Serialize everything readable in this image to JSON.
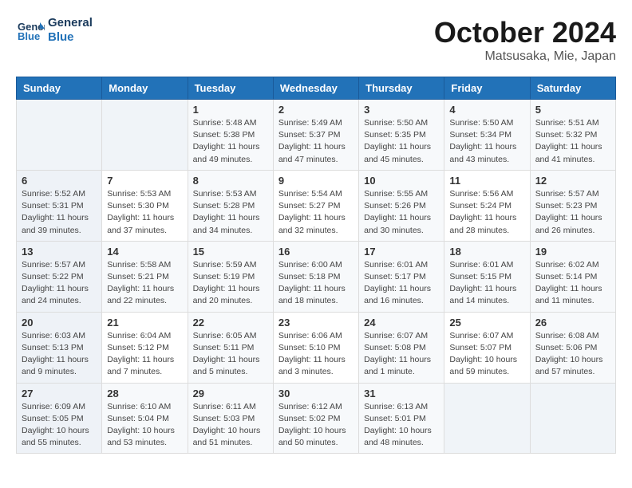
{
  "header": {
    "logo_line1": "General",
    "logo_line2": "Blue",
    "month_title": "October 2024",
    "location": "Matsusaka, Mie, Japan"
  },
  "weekdays": [
    "Sunday",
    "Monday",
    "Tuesday",
    "Wednesday",
    "Thursday",
    "Friday",
    "Saturday"
  ],
  "weeks": [
    [
      {
        "day": "",
        "info": ""
      },
      {
        "day": "",
        "info": ""
      },
      {
        "day": "1",
        "info": "Sunrise: 5:48 AM\nSunset: 5:38 PM\nDaylight: 11 hours and 49 minutes."
      },
      {
        "day": "2",
        "info": "Sunrise: 5:49 AM\nSunset: 5:37 PM\nDaylight: 11 hours and 47 minutes."
      },
      {
        "day": "3",
        "info": "Sunrise: 5:50 AM\nSunset: 5:35 PM\nDaylight: 11 hours and 45 minutes."
      },
      {
        "day": "4",
        "info": "Sunrise: 5:50 AM\nSunset: 5:34 PM\nDaylight: 11 hours and 43 minutes."
      },
      {
        "day": "5",
        "info": "Sunrise: 5:51 AM\nSunset: 5:32 PM\nDaylight: 11 hours and 41 minutes."
      }
    ],
    [
      {
        "day": "6",
        "info": "Sunrise: 5:52 AM\nSunset: 5:31 PM\nDaylight: 11 hours and 39 minutes."
      },
      {
        "day": "7",
        "info": "Sunrise: 5:53 AM\nSunset: 5:30 PM\nDaylight: 11 hours and 37 minutes."
      },
      {
        "day": "8",
        "info": "Sunrise: 5:53 AM\nSunset: 5:28 PM\nDaylight: 11 hours and 34 minutes."
      },
      {
        "day": "9",
        "info": "Sunrise: 5:54 AM\nSunset: 5:27 PM\nDaylight: 11 hours and 32 minutes."
      },
      {
        "day": "10",
        "info": "Sunrise: 5:55 AM\nSunset: 5:26 PM\nDaylight: 11 hours and 30 minutes."
      },
      {
        "day": "11",
        "info": "Sunrise: 5:56 AM\nSunset: 5:24 PM\nDaylight: 11 hours and 28 minutes."
      },
      {
        "day": "12",
        "info": "Sunrise: 5:57 AM\nSunset: 5:23 PM\nDaylight: 11 hours and 26 minutes."
      }
    ],
    [
      {
        "day": "13",
        "info": "Sunrise: 5:57 AM\nSunset: 5:22 PM\nDaylight: 11 hours and 24 minutes."
      },
      {
        "day": "14",
        "info": "Sunrise: 5:58 AM\nSunset: 5:21 PM\nDaylight: 11 hours and 22 minutes."
      },
      {
        "day": "15",
        "info": "Sunrise: 5:59 AM\nSunset: 5:19 PM\nDaylight: 11 hours and 20 minutes."
      },
      {
        "day": "16",
        "info": "Sunrise: 6:00 AM\nSunset: 5:18 PM\nDaylight: 11 hours and 18 minutes."
      },
      {
        "day": "17",
        "info": "Sunrise: 6:01 AM\nSunset: 5:17 PM\nDaylight: 11 hours and 16 minutes."
      },
      {
        "day": "18",
        "info": "Sunrise: 6:01 AM\nSunset: 5:15 PM\nDaylight: 11 hours and 14 minutes."
      },
      {
        "day": "19",
        "info": "Sunrise: 6:02 AM\nSunset: 5:14 PM\nDaylight: 11 hours and 11 minutes."
      }
    ],
    [
      {
        "day": "20",
        "info": "Sunrise: 6:03 AM\nSunset: 5:13 PM\nDaylight: 11 hours and 9 minutes."
      },
      {
        "day": "21",
        "info": "Sunrise: 6:04 AM\nSunset: 5:12 PM\nDaylight: 11 hours and 7 minutes."
      },
      {
        "day": "22",
        "info": "Sunrise: 6:05 AM\nSunset: 5:11 PM\nDaylight: 11 hours and 5 minutes."
      },
      {
        "day": "23",
        "info": "Sunrise: 6:06 AM\nSunset: 5:10 PM\nDaylight: 11 hours and 3 minutes."
      },
      {
        "day": "24",
        "info": "Sunrise: 6:07 AM\nSunset: 5:08 PM\nDaylight: 11 hours and 1 minute."
      },
      {
        "day": "25",
        "info": "Sunrise: 6:07 AM\nSunset: 5:07 PM\nDaylight: 10 hours and 59 minutes."
      },
      {
        "day": "26",
        "info": "Sunrise: 6:08 AM\nSunset: 5:06 PM\nDaylight: 10 hours and 57 minutes."
      }
    ],
    [
      {
        "day": "27",
        "info": "Sunrise: 6:09 AM\nSunset: 5:05 PM\nDaylight: 10 hours and 55 minutes."
      },
      {
        "day": "28",
        "info": "Sunrise: 6:10 AM\nSunset: 5:04 PM\nDaylight: 10 hours and 53 minutes."
      },
      {
        "day": "29",
        "info": "Sunrise: 6:11 AM\nSunset: 5:03 PM\nDaylight: 10 hours and 51 minutes."
      },
      {
        "day": "30",
        "info": "Sunrise: 6:12 AM\nSunset: 5:02 PM\nDaylight: 10 hours and 50 minutes."
      },
      {
        "day": "31",
        "info": "Sunrise: 6:13 AM\nSunset: 5:01 PM\nDaylight: 10 hours and 48 minutes."
      },
      {
        "day": "",
        "info": ""
      },
      {
        "day": "",
        "info": ""
      }
    ]
  ]
}
